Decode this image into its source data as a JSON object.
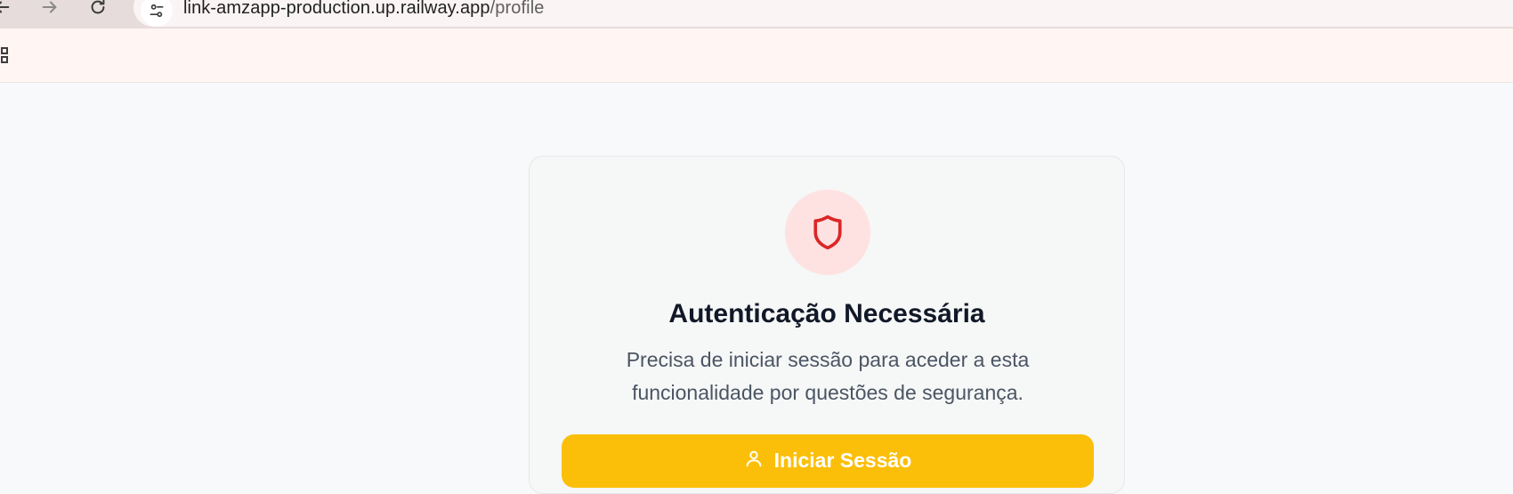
{
  "browser": {
    "url_host": "link-amzapp-production.up.railway.app",
    "url_path": "/profile",
    "icons": {
      "back": "back-arrow-icon",
      "forward": "forward-arrow-icon",
      "reload": "reload-icon",
      "site_info": "tune-icon",
      "apps": "apps-grid-icon"
    }
  },
  "auth_card": {
    "icon": "shield-icon",
    "title": "Autenticação Necessária",
    "description": "Precisa de iniciar sessão para aceder a esta funcionalidade por questões de segurança.",
    "login_button_label": "Iniciar Sessão",
    "login_button_icon": "user-icon"
  },
  "colors": {
    "accent": "#fbbf09",
    "shield_bg": "#fee2e2",
    "shield_stroke": "#dc2626",
    "title": "#111827",
    "description": "#4b5563"
  }
}
